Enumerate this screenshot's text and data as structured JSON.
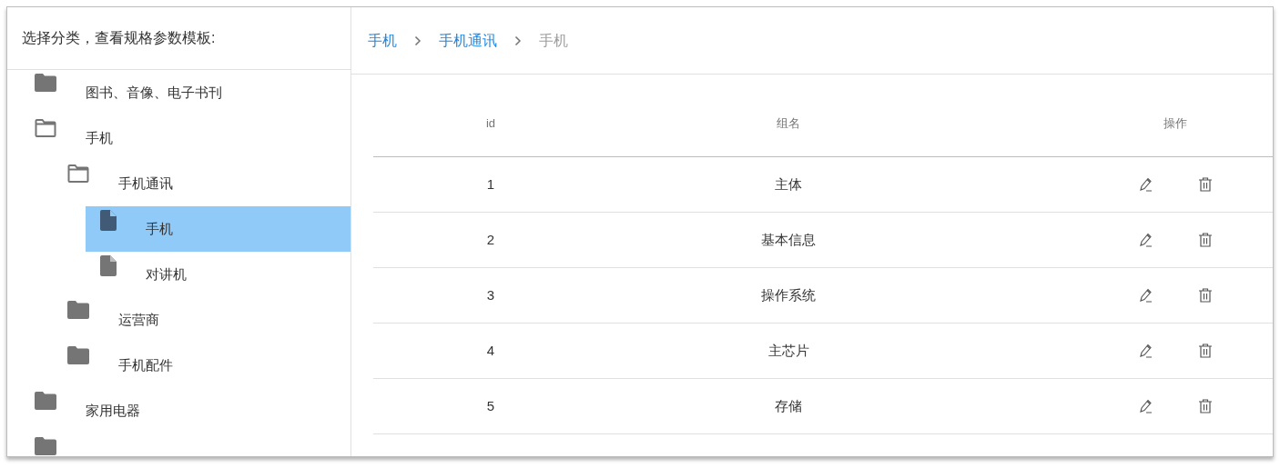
{
  "sidebar": {
    "title": "选择分类，查看规格参数模板:",
    "tree": [
      {
        "label": "图书、音像、电子书刊",
        "kind": "folder",
        "expanded": false,
        "selected": false
      },
      {
        "label": "手机",
        "kind": "folder",
        "expanded": true,
        "selected": false,
        "children": [
          {
            "label": "手机通讯",
            "kind": "folder",
            "expanded": true,
            "selected": false,
            "children": [
              {
                "label": "手机",
                "kind": "file",
                "selected": true
              },
              {
                "label": "对讲机",
                "kind": "file",
                "selected": false
              }
            ]
          },
          {
            "label": "运营商",
            "kind": "folder",
            "expanded": false,
            "selected": false
          },
          {
            "label": "手机配件",
            "kind": "folder",
            "expanded": false,
            "selected": false
          }
        ]
      },
      {
        "label": "家用电器",
        "kind": "folder",
        "expanded": false,
        "selected": false
      },
      {
        "kind": "folder",
        "expanded": false,
        "selected": false
      }
    ]
  },
  "breadcrumb": [
    {
      "label": "手机",
      "link": true
    },
    {
      "label": "手机通讯",
      "link": true
    },
    {
      "label": "手机",
      "link": false
    }
  ],
  "table": {
    "columns": [
      "id",
      "组名",
      "操作"
    ],
    "rows": [
      {
        "id": "1",
        "name": "主体"
      },
      {
        "id": "2",
        "name": "基本信息"
      },
      {
        "id": "3",
        "name": "操作系统"
      },
      {
        "id": "4",
        "name": "主芯片"
      },
      {
        "id": "5",
        "name": "存储"
      }
    ]
  }
}
